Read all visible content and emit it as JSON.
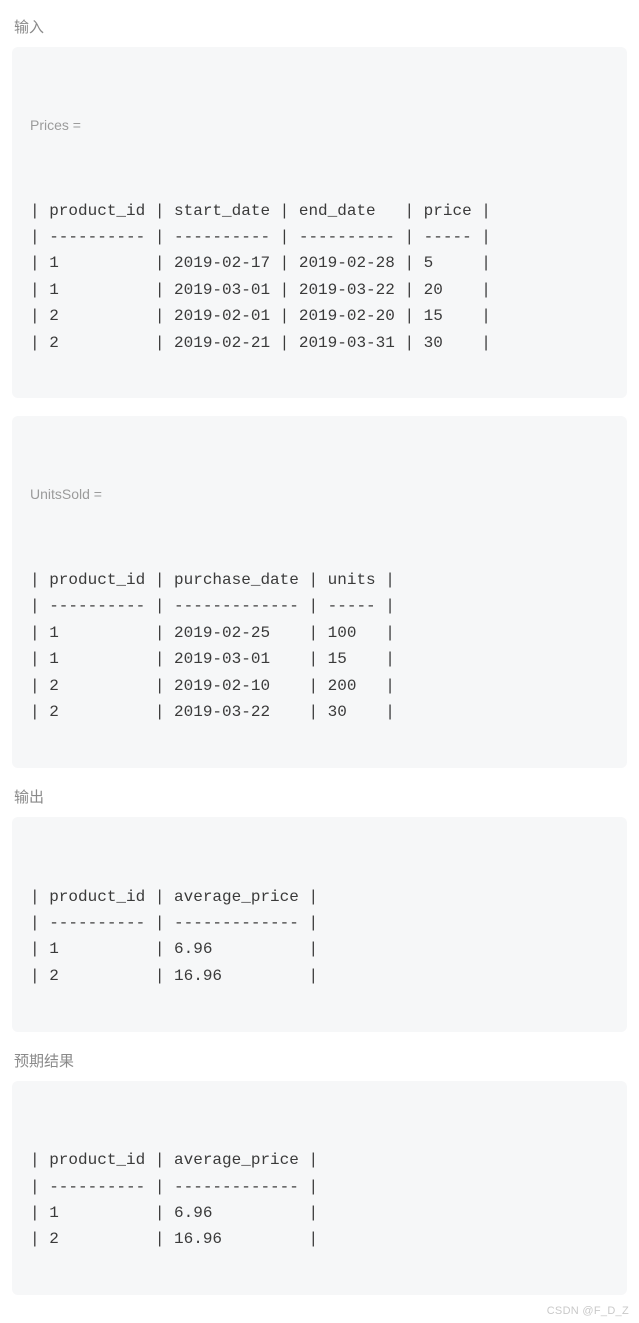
{
  "labels": {
    "input": "输入",
    "output": "输出",
    "expected": "预期结果"
  },
  "block1": {
    "title": "Prices =",
    "lines": [
      "| product_id | start_date | end_date   | price |",
      "| ---------- | ---------- | ---------- | ----- |",
      "| 1          | 2019-02-17 | 2019-02-28 | 5     |",
      "| 1          | 2019-03-01 | 2019-03-22 | 20    |",
      "| 2          | 2019-02-01 | 2019-02-20 | 15    |",
      "| 2          | 2019-02-21 | 2019-03-31 | 30    |"
    ]
  },
  "block2": {
    "title": "UnitsSold =",
    "lines": [
      "| product_id | purchase_date | units |",
      "| ---------- | ------------- | ----- |",
      "| 1          | 2019-02-25    | 100   |",
      "| 1          | 2019-03-01    | 15    |",
      "| 2          | 2019-02-10    | 200   |",
      "| 2          | 2019-03-22    | 30    |"
    ]
  },
  "block3": {
    "lines": [
      "| product_id | average_price |",
      "| ---------- | ------------- |",
      "| 1          | 6.96          |",
      "| 2          | 16.96         |"
    ]
  },
  "block4": {
    "lines": [
      "| product_id | average_price |",
      "| ---------- | ------------- |",
      "| 1          | 6.96          |",
      "| 2          | 16.96         |"
    ]
  },
  "watermark": "CSDN @F_D_Z",
  "chart_data": {
    "type": "table",
    "tables": [
      {
        "name": "Prices",
        "columns": [
          "product_id",
          "start_date",
          "end_date",
          "price"
        ],
        "rows": [
          [
            1,
            "2019-02-17",
            "2019-02-28",
            5
          ],
          [
            1,
            "2019-03-01",
            "2019-03-22",
            20
          ],
          [
            2,
            "2019-02-01",
            "2019-02-20",
            15
          ],
          [
            2,
            "2019-02-21",
            "2019-03-31",
            30
          ]
        ]
      },
      {
        "name": "UnitsSold",
        "columns": [
          "product_id",
          "purchase_date",
          "units"
        ],
        "rows": [
          [
            1,
            "2019-02-25",
            100
          ],
          [
            1,
            "2019-03-01",
            15
          ],
          [
            2,
            "2019-02-10",
            200
          ],
          [
            2,
            "2019-03-22",
            30
          ]
        ]
      },
      {
        "name": "Output",
        "columns": [
          "product_id",
          "average_price"
        ],
        "rows": [
          [
            1,
            6.96
          ],
          [
            2,
            16.96
          ]
        ]
      },
      {
        "name": "Expected",
        "columns": [
          "product_id",
          "average_price"
        ],
        "rows": [
          [
            1,
            6.96
          ],
          [
            2,
            16.96
          ]
        ]
      }
    ]
  }
}
